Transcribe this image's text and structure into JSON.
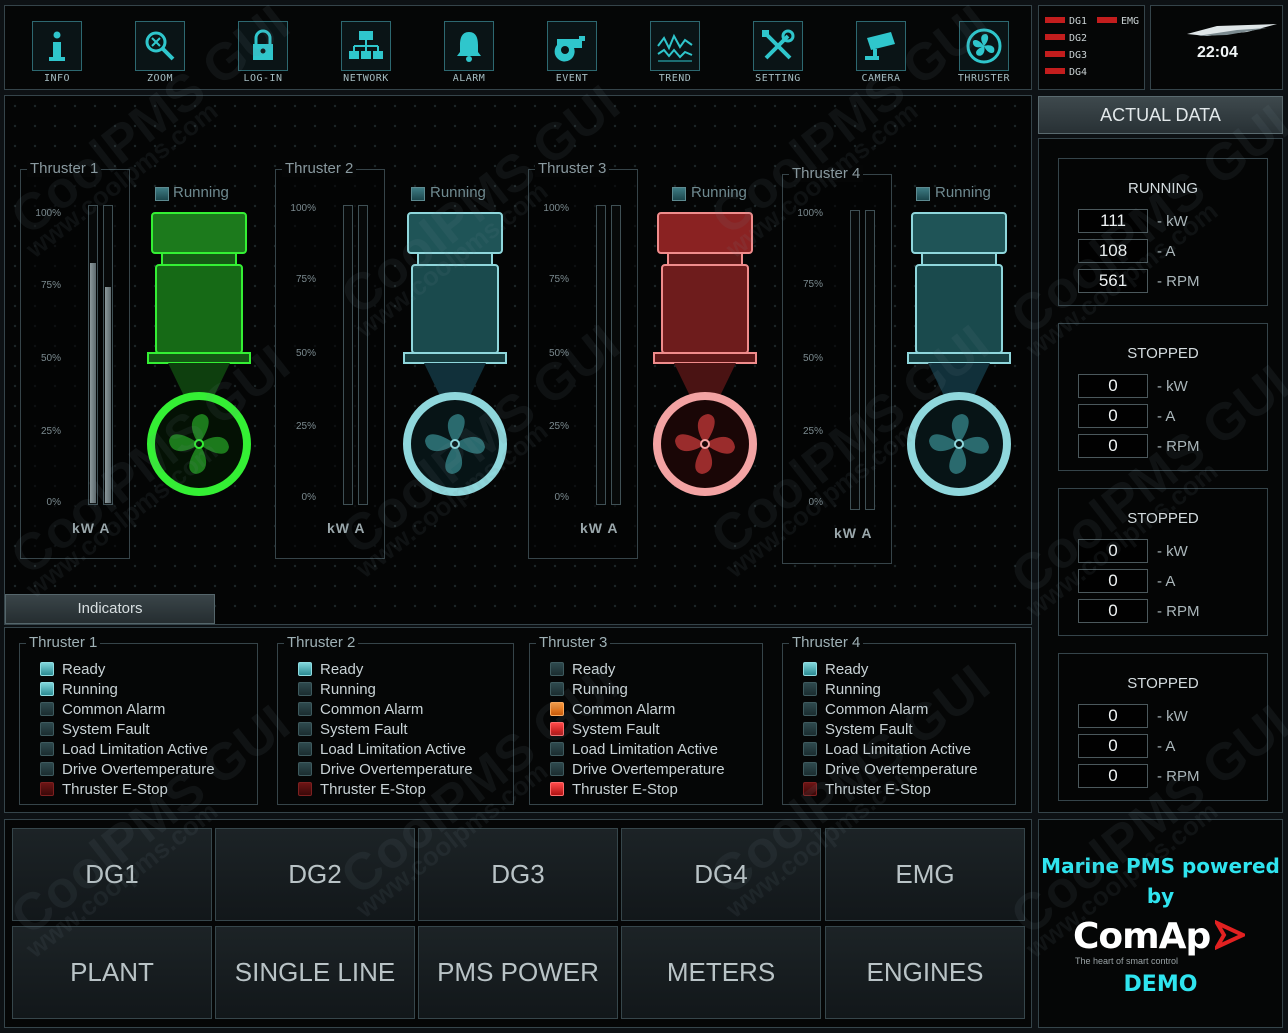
{
  "toolbar": {
    "buttons": [
      {
        "label": "INFO",
        "icon": "info-icon"
      },
      {
        "label": "ZOOM",
        "icon": "zoom-icon"
      },
      {
        "label": "LOG-IN",
        "icon": "lock-icon"
      },
      {
        "label": "NETWORK",
        "icon": "network-icon"
      },
      {
        "label": "ALARM",
        "icon": "bell-icon"
      },
      {
        "label": "EVENT",
        "icon": "whistle-icon"
      },
      {
        "label": "TREND",
        "icon": "trend-icon"
      },
      {
        "label": "SETTING",
        "icon": "tools-icon"
      },
      {
        "label": "CAMERA",
        "icon": "camera-icon"
      },
      {
        "label": "THRUSTER",
        "icon": "fan-icon"
      }
    ]
  },
  "gen_status": {
    "items": [
      "DG1",
      "EMG",
      "DG2",
      "DG3",
      "DG4"
    ],
    "color": "#c31d1d"
  },
  "clock": {
    "time": "22:04"
  },
  "thrusters": [
    {
      "name": "Thruster 1",
      "running_label": "Running",
      "ticks": [
        "100%",
        "75%",
        "50%",
        "25%",
        "0%"
      ],
      "units": "kW A",
      "kw_fraction": 0.81,
      "a_fraction": 0.73,
      "color": "#28e628"
    },
    {
      "name": "Thruster 2",
      "running_label": "Running",
      "ticks": [
        "100%",
        "75%",
        "50%",
        "25%",
        "0%"
      ],
      "units": "kW A",
      "kw_fraction": 0,
      "a_fraction": 0,
      "color": "#8fd7dc"
    },
    {
      "name": "Thruster 3",
      "running_label": "Running",
      "ticks": [
        "100%",
        "75%",
        "50%",
        "25%",
        "0%"
      ],
      "units": "kW A",
      "kw_fraction": 0,
      "a_fraction": 0,
      "color": "#f08c8c"
    },
    {
      "name": "Thruster 4",
      "running_label": "Running",
      "ticks": [
        "100%",
        "75%",
        "50%",
        "25%",
        "0%"
      ],
      "units": "kW A",
      "kw_fraction": 0,
      "a_fraction": 0,
      "color": "#8fd7dc"
    }
  ],
  "indicators": {
    "tab_label": "Indicators",
    "labels": [
      "Ready",
      "Running",
      "Common Alarm",
      "System Fault",
      "Load Limitation Active",
      "Drive Overtemperature",
      "Thruster E-Stop"
    ],
    "groups": [
      {
        "name": "Thruster 1",
        "states": [
          "on",
          "on",
          "off",
          "off",
          "off",
          "off",
          "darkred"
        ]
      },
      {
        "name": "Thruster 2",
        "states": [
          "on",
          "off",
          "off",
          "off",
          "off",
          "off",
          "darkred"
        ]
      },
      {
        "name": "Thruster 3",
        "states": [
          "off",
          "off",
          "orange",
          "red",
          "off",
          "off",
          "red"
        ]
      },
      {
        "name": "Thruster 4",
        "states": [
          "on",
          "off",
          "off",
          "off",
          "off",
          "off",
          "darkred"
        ]
      }
    ]
  },
  "actual_data": {
    "title": "ACTUAL DATA",
    "units": [
      "- kW",
      "- A",
      "- RPM"
    ],
    "cards": [
      {
        "status": "RUNNING",
        "values": [
          "111",
          "108",
          "561"
        ]
      },
      {
        "status": "STOPPED",
        "values": [
          "0",
          "0",
          "0"
        ]
      },
      {
        "status": "STOPPED",
        "values": [
          "0",
          "0",
          "0"
        ]
      },
      {
        "status": "STOPPED",
        "values": [
          "0",
          "0",
          "0"
        ]
      }
    ]
  },
  "nav": {
    "row1": [
      "DG1",
      "DG2",
      "DG3",
      "DG4",
      "EMG"
    ],
    "row2": [
      "PLANT",
      "SINGLE LINE",
      "PMS POWER",
      "METERS",
      "ENGINES"
    ]
  },
  "brand": {
    "line1": "Marine PMS powered",
    "line2": "by",
    "logo": "ComAp",
    "tagline": "The heart of smart control",
    "demo": "DEMO"
  },
  "watermark": {
    "texts": [
      "CoolPMS GUI",
      "www.coolpms.com"
    ]
  }
}
